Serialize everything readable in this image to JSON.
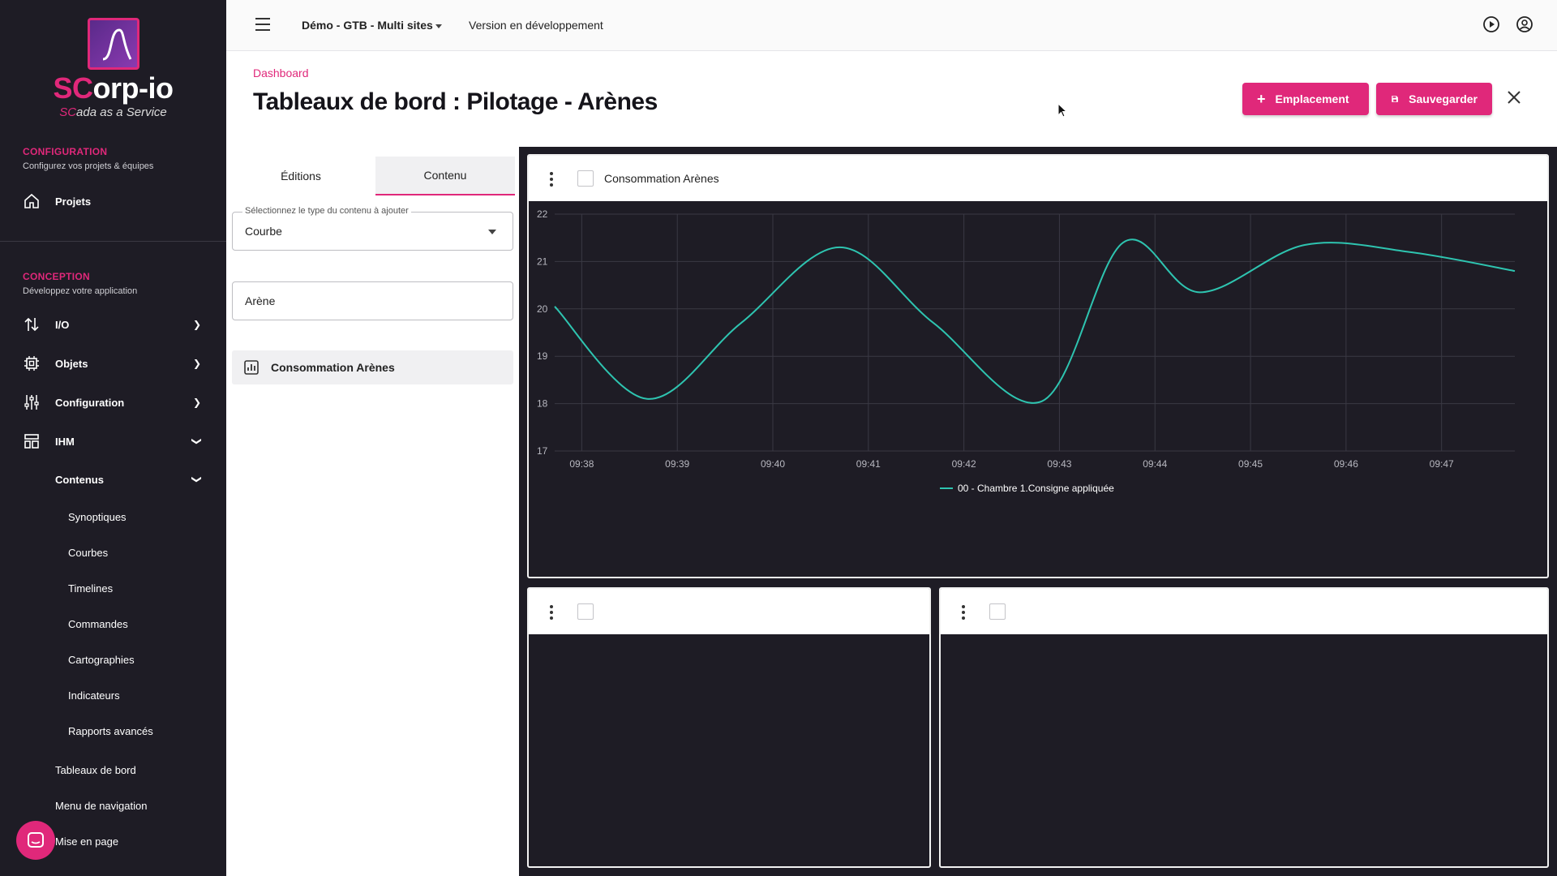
{
  "brand": {
    "logo_prefix": "SC",
    "logo_suffix": "orp-io",
    "tagline_prefix": "SC",
    "tagline_suffix": "ada as a Service",
    "accent": "#e0287a"
  },
  "sidebar": {
    "configuration": {
      "title": "CONFIGURATION",
      "subtitle": "Configurez vos projets & équipes",
      "items": [
        {
          "label": "Projets",
          "icon": "home-icon"
        }
      ]
    },
    "conception": {
      "title": "CONCEPTION",
      "subtitle": "Développez votre application",
      "items": [
        {
          "label": "I/O",
          "icon": "io-arrows-icon"
        },
        {
          "label": "Objets",
          "icon": "chip-icon"
        },
        {
          "label": "Configuration",
          "icon": "sliders-icon"
        },
        {
          "label": "IHM",
          "icon": "layout-icon"
        }
      ],
      "contenus_label": "Contenus",
      "contenus_items": [
        "Synoptiques",
        "Courbes",
        "Timelines",
        "Commandes",
        "Cartographies",
        "Indicateurs",
        "Rapports avancés"
      ],
      "more_items": [
        "Tableaux de bord",
        "Menu de navigation",
        "Mise en page"
      ]
    }
  },
  "topbar": {
    "project": "Démo - GTB - Multi sites",
    "version": "Version en développement"
  },
  "header": {
    "breadcrumb": "Dashboard",
    "title": "Tableaux de bord : Pilotage - Arènes",
    "add_button": "Emplacement",
    "save_button": "Sauvegarder"
  },
  "panel": {
    "tabs": [
      "Éditions",
      "Contenu"
    ],
    "active_tab": "Contenu",
    "type_select": {
      "label": "Sélectionnez le type du contenu à ajouter",
      "value": "Courbe"
    },
    "search": {
      "value": "Arène"
    },
    "results": [
      {
        "label": "Consommation Arènes"
      }
    ]
  },
  "widgets": [
    {
      "title": "Consommation Arènes"
    },
    {
      "title": ""
    },
    {
      "title": ""
    }
  ],
  "chart_data": {
    "type": "line",
    "title": "",
    "xlabel": "",
    "ylabel": "",
    "x_ticks": [
      "09:38",
      "09:39",
      "09:40",
      "09:41",
      "09:42",
      "09:43",
      "09:44",
      "09:45",
      "09:46",
      "09:47"
    ],
    "y_ticks": [
      22,
      21,
      20,
      19,
      18,
      17
    ],
    "ylim": [
      17,
      22
    ],
    "grid": true,
    "legend_position": "bottom-center",
    "series": [
      {
        "name": "00 - Chambre 1.Consigne appliquée",
        "color": "#2ec4b0",
        "x": [
          "09:37:43",
          "09:38:41",
          "09:39:40",
          "09:40:42",
          "09:41:41",
          "09:42:49",
          "09:43:40",
          "09:44:28",
          "09:45:34",
          "09:46:40",
          "09:47:46"
        ],
        "y": [
          20.05,
          18.1,
          19.7,
          21.3,
          19.7,
          18.05,
          21.4,
          20.35,
          21.35,
          21.2,
          20.8
        ]
      }
    ]
  }
}
